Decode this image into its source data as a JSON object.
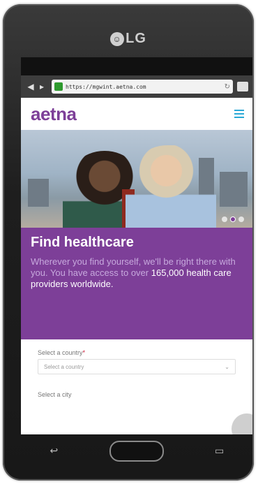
{
  "device": {
    "brand": "LG"
  },
  "statusbar": {
    "left": "",
    "icons": "",
    "time": ""
  },
  "browser": {
    "url": "https://mgwint.aetna.com"
  },
  "header": {
    "logo": "aetna"
  },
  "hero": {
    "slide_count": 3
  },
  "promo": {
    "title": "Find healthcare",
    "body": "Wherever you find yourself, we'll be right there with you. You have access to over",
    "highlight": "165,000 health care providers worldwide."
  },
  "form": {
    "country_label": "Select a country",
    "required_mark": "*",
    "country_placeholder": "Select a country",
    "city_label": "Select a city"
  },
  "colors": {
    "brand_purple": "#7d3f98",
    "menu_blue": "#2aa9d6"
  }
}
